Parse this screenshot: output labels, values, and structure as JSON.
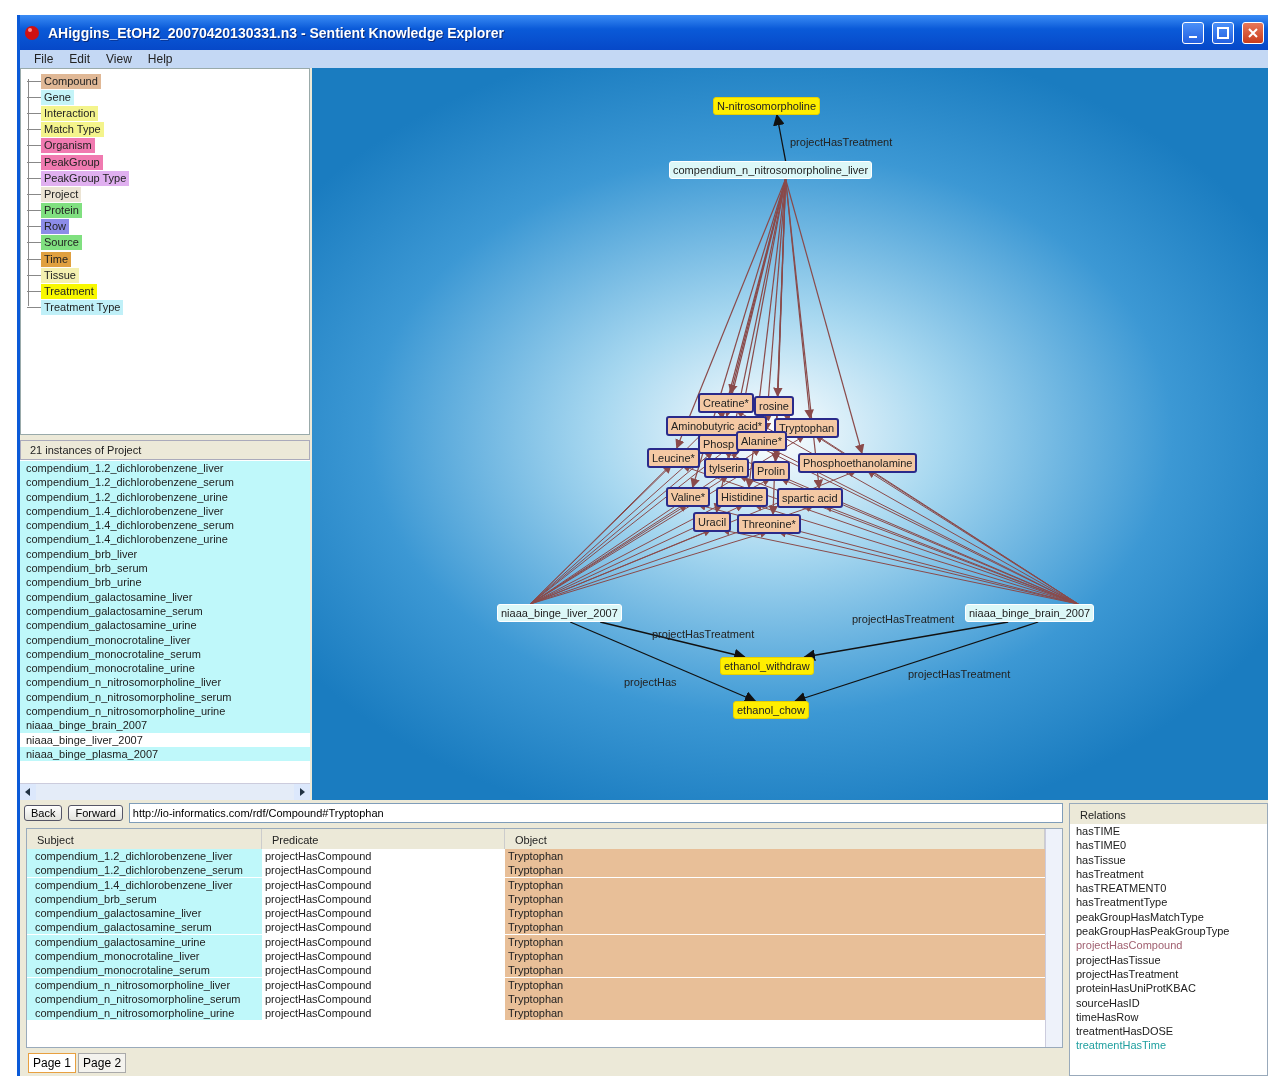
{
  "window": {
    "title": "AHiggins_EtOH2_20070420130331.n3 - Sentient Knowledge Explorer"
  },
  "menu": [
    "File",
    "Edit",
    "View",
    "Help"
  ],
  "class_tree": [
    {
      "label": "Compound",
      "color": "#e0b896"
    },
    {
      "label": "Gene",
      "color": "#c4f4f8"
    },
    {
      "label": "Interaction",
      "color": "#f4f48c"
    },
    {
      "label": "Match Type",
      "color": "#f4f48c"
    },
    {
      "label": "Organism",
      "color": "#f07ab0"
    },
    {
      "label": "PeakGroup",
      "color": "#f07ab0"
    },
    {
      "label": "PeakGroup Type",
      "color": "#e0b0f0"
    },
    {
      "label": "Project",
      "color": "#ece4d4"
    },
    {
      "label": "Protein",
      "color": "#80e080"
    },
    {
      "label": "Row",
      "color": "#8c8ce8"
    },
    {
      "label": "Source",
      "color": "#80e080"
    },
    {
      "label": "Time",
      "color": "#e0a040"
    },
    {
      "label": "Tissue",
      "color": "#f4f0b0"
    },
    {
      "label": "Treatment",
      "color": "#f8f800"
    },
    {
      "label": "Treatment Type",
      "color": "#c0f0f8"
    }
  ],
  "instances": {
    "header": "21 instances of Project",
    "items": [
      {
        "label": "compendium_1.2_dichlorobenzene_liver",
        "selected": true
      },
      {
        "label": "compendium_1.2_dichlorobenzene_serum",
        "selected": true
      },
      {
        "label": "compendium_1.2_dichlorobenzene_urine",
        "selected": true
      },
      {
        "label": "compendium_1.4_dichlorobenzene_liver",
        "selected": true
      },
      {
        "label": "compendium_1.4_dichlorobenzene_serum",
        "selected": true
      },
      {
        "label": "compendium_1.4_dichlorobenzene_urine",
        "selected": true
      },
      {
        "label": "compendium_brb_liver",
        "selected": true
      },
      {
        "label": "compendium_brb_serum",
        "selected": true
      },
      {
        "label": "compendium_brb_urine",
        "selected": true
      },
      {
        "label": "compendium_galactosamine_liver",
        "selected": true
      },
      {
        "label": "compendium_galactosamine_serum",
        "selected": true
      },
      {
        "label": "compendium_galactosamine_urine",
        "selected": true
      },
      {
        "label": "compendium_monocrotaline_liver",
        "selected": true
      },
      {
        "label": "compendium_monocrotaline_serum",
        "selected": true
      },
      {
        "label": "compendium_monocrotaline_urine",
        "selected": true
      },
      {
        "label": "compendium_n_nitrosomorpholine_liver",
        "selected": true
      },
      {
        "label": "compendium_n_nitrosomorpholine_serum",
        "selected": true
      },
      {
        "label": "compendium_n_nitrosomorpholine_urine",
        "selected": true
      },
      {
        "label": "niaaa_binge_brain_2007",
        "selected": true
      },
      {
        "label": "niaaa_binge_liver_2007",
        "selected": false
      },
      {
        "label": "niaaa_binge_plasma_2007",
        "selected": true
      }
    ]
  },
  "graph": {
    "nodes": [
      {
        "label": "N-nitrosomorpholine",
        "kind": "treatment"
      },
      {
        "label": "compendium_n_nitrosomorpholine_liver",
        "kind": "project"
      },
      {
        "label": "Creatine*",
        "kind": "compound"
      },
      {
        "label": "rosine",
        "kind": "compound"
      },
      {
        "label": "Aminobutyric acid*",
        "kind": "compound"
      },
      {
        "label": "Tryptophan",
        "kind": "compound"
      },
      {
        "label": "Phosp",
        "kind": "compound"
      },
      {
        "label": "Alanine*",
        "kind": "compound"
      },
      {
        "label": "Leucine*",
        "kind": "compound"
      },
      {
        "label": "tylserin",
        "kind": "compound"
      },
      {
        "label": "Prolin",
        "kind": "compound"
      },
      {
        "label": "Phosphoethanolamine",
        "kind": "compound"
      },
      {
        "label": "Valine*",
        "kind": "compound"
      },
      {
        "label": "Histidine",
        "kind": "compound"
      },
      {
        "label": "spartic acid",
        "kind": "compound"
      },
      {
        "label": "Uracil",
        "kind": "compound"
      },
      {
        "label": "Threonine*",
        "kind": "compound"
      },
      {
        "label": "niaaa_binge_liver_2007",
        "kind": "project"
      },
      {
        "label": "niaaa_binge_brain_2007",
        "kind": "project"
      },
      {
        "label": "ethanol_withdraw",
        "kind": "treatment"
      },
      {
        "label": "ethanol_chow",
        "kind": "treatment"
      }
    ],
    "edge_labels": [
      "projectHasTreatment",
      "projectHasTreatment",
      "projectHas",
      "projectHasTreatment",
      "projectHasTreatment"
    ]
  },
  "navigation": {
    "back": "Back",
    "forward": "Forward",
    "address": "http://io-informatics.com/rdf/Compound#Tryptophan"
  },
  "table": {
    "columns": [
      "Subject",
      "Predicate",
      "Object"
    ],
    "rows": [
      [
        "compendium_1.2_dichlorobenzene_liver",
        "projectHasCompound",
        "Tryptophan"
      ],
      [
        "compendium_1.2_dichlorobenzene_serum",
        "projectHasCompound",
        "Tryptophan"
      ],
      [
        "compendium_1.4_dichlorobenzene_liver",
        "projectHasCompound",
        "Tryptophan"
      ],
      [
        "compendium_brb_serum",
        "projectHasCompound",
        "Tryptophan"
      ],
      [
        "compendium_galactosamine_liver",
        "projectHasCompound",
        "Tryptophan"
      ],
      [
        "compendium_galactosamine_serum",
        "projectHasCompound",
        "Tryptophan"
      ],
      [
        "compendium_galactosamine_urine",
        "projectHasCompound",
        "Tryptophan"
      ],
      [
        "compendium_monocrotaline_liver",
        "projectHasCompound",
        "Tryptophan"
      ],
      [
        "compendium_monocrotaline_serum",
        "projectHasCompound",
        "Tryptophan"
      ],
      [
        "compendium_n_nitrosomorpholine_liver",
        "projectHasCompound",
        "Tryptophan"
      ],
      [
        "compendium_n_nitrosomorpholine_serum",
        "projectHasCompound",
        "Tryptophan"
      ],
      [
        "compendium_n_nitrosomorpholine_urine",
        "projectHasCompound",
        "Tryptophan"
      ]
    ]
  },
  "pages": [
    {
      "label": "Page 1",
      "selected": true
    },
    {
      "label": "Page 2",
      "selected": false
    }
  ],
  "relations": {
    "header": "Relations",
    "items": [
      {
        "label": "hasTIME",
        "color": "#202020"
      },
      {
        "label": "hasTIME0",
        "color": "#202020"
      },
      {
        "label": "hasTissue",
        "color": "#202020"
      },
      {
        "label": "hasTreatment",
        "color": "#202020"
      },
      {
        "label": "hasTREATMENT0",
        "color": "#202020"
      },
      {
        "label": "hasTreatmentType",
        "color": "#202020"
      },
      {
        "label": "peakGroupHasMatchType",
        "color": "#202020"
      },
      {
        "label": "peakGroupHasPeakGroupType",
        "color": "#202020"
      },
      {
        "label": "projectHasCompound",
        "color": "#a06070"
      },
      {
        "label": "projectHasTissue",
        "color": "#202020"
      },
      {
        "label": "projectHasTreatment",
        "color": "#202020"
      },
      {
        "label": "proteinHasUniProtKBAC",
        "color": "#202020"
      },
      {
        "label": "sourceHasID",
        "color": "#202020"
      },
      {
        "label": "timeHasRow",
        "color": "#202020"
      },
      {
        "label": "treatmentHasDOSE",
        "color": "#202020"
      },
      {
        "label": "treatmentHasTime",
        "color": "#20a0a0"
      }
    ]
  }
}
